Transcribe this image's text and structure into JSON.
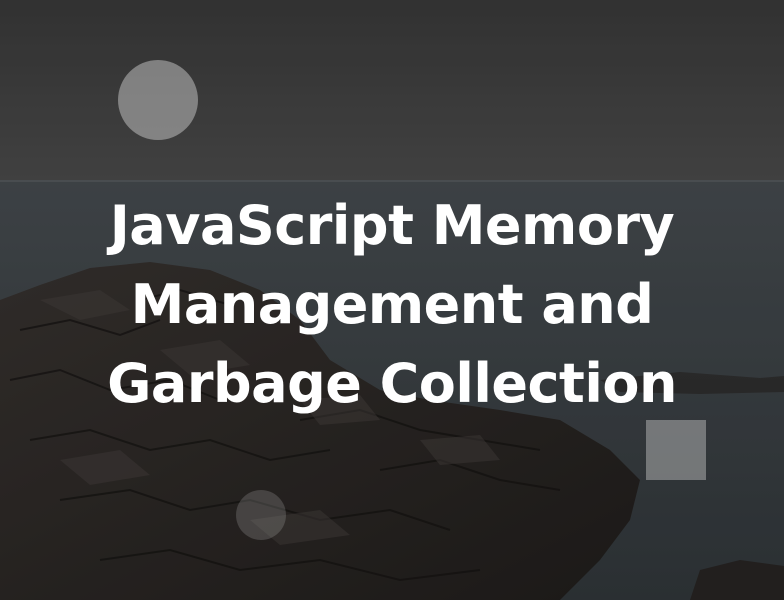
{
  "hero": {
    "title_lines": [
      "JavaScript Memory",
      "Management and",
      "Garbage Collection"
    ]
  },
  "colors": {
    "sky": "#4a4a4a",
    "sea": "#3c4247",
    "rock": "#2b2725",
    "title_text": "#ffffff"
  },
  "decorations": {
    "circle_icon": "circle-shape",
    "square_icon": "square-shape"
  }
}
